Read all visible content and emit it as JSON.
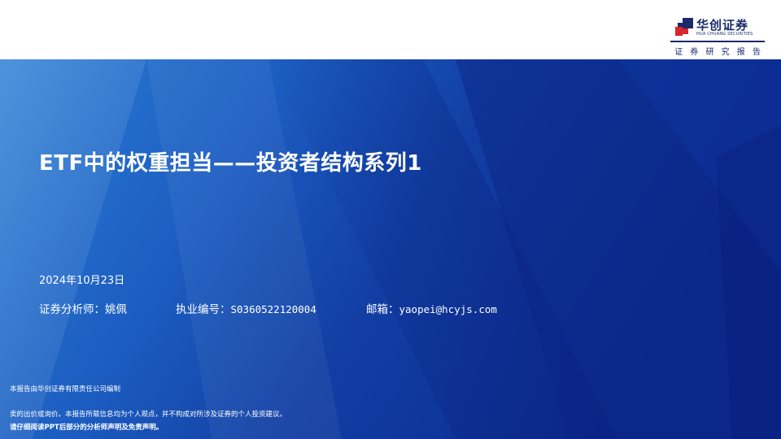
{
  "header": {
    "logo_cn": "华创证券",
    "logo_en": "HUA CHUANG SECURITIES",
    "subtitle": "证 券 研 究 报 告"
  },
  "main": {
    "title": "ETF中的权重担当——投资者结构系列1",
    "date": "2024年10月23日",
    "analyst_label": "证券分析师：",
    "analyst_name": "姚佩",
    "license_label": "执业编号：",
    "license_no": "S0360522120004",
    "email_label": "邮箱：",
    "email": "yaopei@hcyjs.com"
  },
  "footer": {
    "line1": "本报告由华创证券有限责任公司编制",
    "line2": "卖的出价或询价。本报告所载信息均为个人观点，并不构成对所涉及证券的个人投资建议。",
    "line3": "请仔细阅读PPT后部分的分析师声明及免责声明。"
  },
  "colors": {
    "brand_navy": "#1b2a6b",
    "hero_blue_light": "#2b78d2",
    "hero_blue_dark": "#0c2a8c",
    "logo_red": "#d8262c"
  }
}
